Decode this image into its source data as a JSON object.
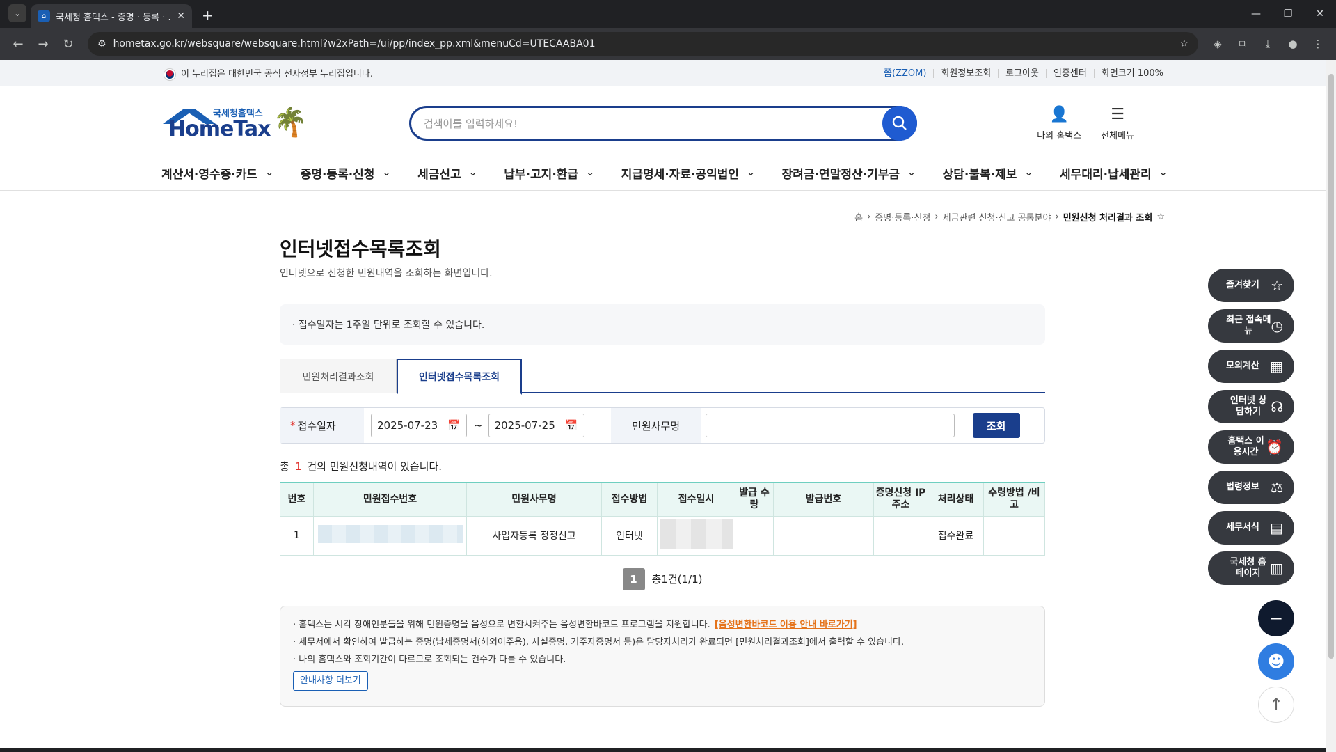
{
  "browser": {
    "tab_title": "국세청 홈택스 - 증명 · 등록 · ...",
    "url": "hometax.go.kr/websquare/websquare.html?w2xPath=/ui/pp/index_pp.xml&menuCd=UTECAABA01"
  },
  "gov_bar": {
    "notice": "이 누리집은 대한민국 공식 전자정부 누리집입니다.",
    "links": [
      "쯤(ZZOM)",
      "회원정보조회",
      "로그아웃",
      "인증센터",
      "화면크기 100%"
    ]
  },
  "header": {
    "logo_small": "국세청홈택스",
    "logo_big": "HomeTax",
    "search_placeholder": "검색어를 입력하세요!",
    "my_hometax": "나의 홈택스",
    "all_menu": "전체메뉴"
  },
  "menu": [
    "계산서·영수증·카드",
    "증명·등록·신청",
    "세금신고",
    "납부·고지·환급",
    "지급명세·자료·공익법인",
    "장려금·연말정산·기부금",
    "상담·불복·제보",
    "세무대리·납세관리"
  ],
  "breadcrumb": [
    "홈",
    "증명·등록·신청",
    "세금관련 신청·신고 공통분야",
    "민원신청 처리결과 조회"
  ],
  "page": {
    "title": "인터넷접수목록조회",
    "subtitle": "인터넷으로 신청한 민원내역을 조회하는 화면입니다.",
    "notice": "· 접수일자는 1주일 단위로 조회할 수 있습니다.",
    "tabs": [
      "민원처리결과조회",
      "인터넷접수목록조회"
    ]
  },
  "filter": {
    "date_label": "접수일자",
    "date_from": "2025-07-23",
    "date_to": "2025-07-25",
    "name_label": "민원사무명",
    "name_value": "",
    "search_btn": "조회"
  },
  "result": {
    "prefix": "총",
    "count": "1",
    "suffix": "건의 민원신청내역이 있습니다.",
    "columns": [
      "번호",
      "민원접수번호",
      "민원사무명",
      "접수방법",
      "접수일시",
      "발급 수량",
      "발급번호",
      "증명신청 IP주소",
      "처리상태",
      "수령방법 /비고"
    ],
    "rows": [
      {
        "no": "1",
        "office": "사업자등록 정정신고",
        "method": "인터넷",
        "qty": "",
        "issue_no": "",
        "ip": "",
        "status": "접수완료",
        "note": ""
      }
    ]
  },
  "pager": {
    "page": "1",
    "summary": "총1건(1/1)"
  },
  "info": {
    "line1": "· 홈택스는 시각 장애인분들을 위해 민원증명을 음성으로 변환시켜주는 음성변환바코드 프로그램을 지원합니다.",
    "line1_link": "[음성변환바코드 이용 안내 바로가기]",
    "line2": "· 세무서에서 확인하여 발급하는 증명(납세증명서(해외이주용), 사실증명, 거주자증명서 등)은 담당자처리가 완료되면 [민원처리결과조회]에서 출력할 수 있습니다.",
    "line3": "· 나의 홈택스와 조회기간이 다르므로 조회되는 건수가 다를 수 있습니다.",
    "more_btn": "안내사항 더보기"
  },
  "quick_menu": [
    "즐겨찾기",
    "최근 접속메뉴",
    "모의계산",
    "인터넷 상담하기",
    "홈택스 이용시간",
    "법령정보",
    "세무서식",
    "국세청 홈페이지"
  ]
}
